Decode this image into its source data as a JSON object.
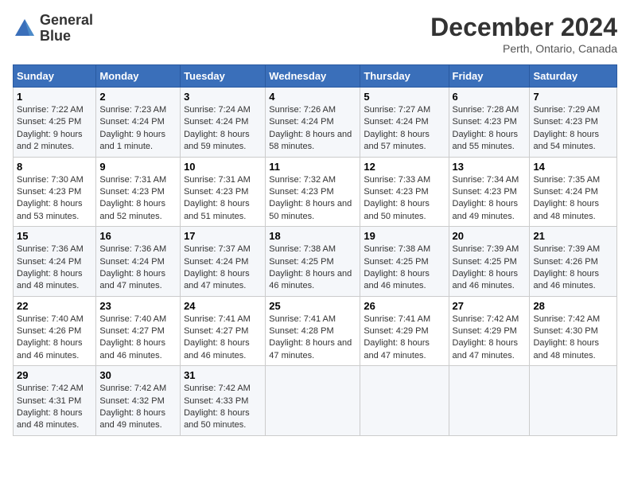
{
  "header": {
    "logo_line1": "General",
    "logo_line2": "Blue",
    "main_title": "December 2024",
    "subtitle": "Perth, Ontario, Canada"
  },
  "days_of_week": [
    "Sunday",
    "Monday",
    "Tuesday",
    "Wednesday",
    "Thursday",
    "Friday",
    "Saturday"
  ],
  "weeks": [
    [
      {
        "day": "1",
        "sunrise": "Sunrise: 7:22 AM",
        "sunset": "Sunset: 4:25 PM",
        "daylight": "Daylight: 9 hours and 2 minutes."
      },
      {
        "day": "2",
        "sunrise": "Sunrise: 7:23 AM",
        "sunset": "Sunset: 4:24 PM",
        "daylight": "Daylight: 9 hours and 1 minute."
      },
      {
        "day": "3",
        "sunrise": "Sunrise: 7:24 AM",
        "sunset": "Sunset: 4:24 PM",
        "daylight": "Daylight: 8 hours and 59 minutes."
      },
      {
        "day": "4",
        "sunrise": "Sunrise: 7:26 AM",
        "sunset": "Sunset: 4:24 PM",
        "daylight": "Daylight: 8 hours and 58 minutes."
      },
      {
        "day": "5",
        "sunrise": "Sunrise: 7:27 AM",
        "sunset": "Sunset: 4:24 PM",
        "daylight": "Daylight: 8 hours and 57 minutes."
      },
      {
        "day": "6",
        "sunrise": "Sunrise: 7:28 AM",
        "sunset": "Sunset: 4:23 PM",
        "daylight": "Daylight: 8 hours and 55 minutes."
      },
      {
        "day": "7",
        "sunrise": "Sunrise: 7:29 AM",
        "sunset": "Sunset: 4:23 PM",
        "daylight": "Daylight: 8 hours and 54 minutes."
      }
    ],
    [
      {
        "day": "8",
        "sunrise": "Sunrise: 7:30 AM",
        "sunset": "Sunset: 4:23 PM",
        "daylight": "Daylight: 8 hours and 53 minutes."
      },
      {
        "day": "9",
        "sunrise": "Sunrise: 7:31 AM",
        "sunset": "Sunset: 4:23 PM",
        "daylight": "Daylight: 8 hours and 52 minutes."
      },
      {
        "day": "10",
        "sunrise": "Sunrise: 7:31 AM",
        "sunset": "Sunset: 4:23 PM",
        "daylight": "Daylight: 8 hours and 51 minutes."
      },
      {
        "day": "11",
        "sunrise": "Sunrise: 7:32 AM",
        "sunset": "Sunset: 4:23 PM",
        "daylight": "Daylight: 8 hours and 50 minutes."
      },
      {
        "day": "12",
        "sunrise": "Sunrise: 7:33 AM",
        "sunset": "Sunset: 4:23 PM",
        "daylight": "Daylight: 8 hours and 50 minutes."
      },
      {
        "day": "13",
        "sunrise": "Sunrise: 7:34 AM",
        "sunset": "Sunset: 4:23 PM",
        "daylight": "Daylight: 8 hours and 49 minutes."
      },
      {
        "day": "14",
        "sunrise": "Sunrise: 7:35 AM",
        "sunset": "Sunset: 4:24 PM",
        "daylight": "Daylight: 8 hours and 48 minutes."
      }
    ],
    [
      {
        "day": "15",
        "sunrise": "Sunrise: 7:36 AM",
        "sunset": "Sunset: 4:24 PM",
        "daylight": "Daylight: 8 hours and 48 minutes."
      },
      {
        "day": "16",
        "sunrise": "Sunrise: 7:36 AM",
        "sunset": "Sunset: 4:24 PM",
        "daylight": "Daylight: 8 hours and 47 minutes."
      },
      {
        "day": "17",
        "sunrise": "Sunrise: 7:37 AM",
        "sunset": "Sunset: 4:24 PM",
        "daylight": "Daylight: 8 hours and 47 minutes."
      },
      {
        "day": "18",
        "sunrise": "Sunrise: 7:38 AM",
        "sunset": "Sunset: 4:25 PM",
        "daylight": "Daylight: 8 hours and 46 minutes."
      },
      {
        "day": "19",
        "sunrise": "Sunrise: 7:38 AM",
        "sunset": "Sunset: 4:25 PM",
        "daylight": "Daylight: 8 hours and 46 minutes."
      },
      {
        "day": "20",
        "sunrise": "Sunrise: 7:39 AM",
        "sunset": "Sunset: 4:25 PM",
        "daylight": "Daylight: 8 hours and 46 minutes."
      },
      {
        "day": "21",
        "sunrise": "Sunrise: 7:39 AM",
        "sunset": "Sunset: 4:26 PM",
        "daylight": "Daylight: 8 hours and 46 minutes."
      }
    ],
    [
      {
        "day": "22",
        "sunrise": "Sunrise: 7:40 AM",
        "sunset": "Sunset: 4:26 PM",
        "daylight": "Daylight: 8 hours and 46 minutes."
      },
      {
        "day": "23",
        "sunrise": "Sunrise: 7:40 AM",
        "sunset": "Sunset: 4:27 PM",
        "daylight": "Daylight: 8 hours and 46 minutes."
      },
      {
        "day": "24",
        "sunrise": "Sunrise: 7:41 AM",
        "sunset": "Sunset: 4:27 PM",
        "daylight": "Daylight: 8 hours and 46 minutes."
      },
      {
        "day": "25",
        "sunrise": "Sunrise: 7:41 AM",
        "sunset": "Sunset: 4:28 PM",
        "daylight": "Daylight: 8 hours and 47 minutes."
      },
      {
        "day": "26",
        "sunrise": "Sunrise: 7:41 AM",
        "sunset": "Sunset: 4:29 PM",
        "daylight": "Daylight: 8 hours and 47 minutes."
      },
      {
        "day": "27",
        "sunrise": "Sunrise: 7:42 AM",
        "sunset": "Sunset: 4:29 PM",
        "daylight": "Daylight: 8 hours and 47 minutes."
      },
      {
        "day": "28",
        "sunrise": "Sunrise: 7:42 AM",
        "sunset": "Sunset: 4:30 PM",
        "daylight": "Daylight: 8 hours and 48 minutes."
      }
    ],
    [
      {
        "day": "29",
        "sunrise": "Sunrise: 7:42 AM",
        "sunset": "Sunset: 4:31 PM",
        "daylight": "Daylight: 8 hours and 48 minutes."
      },
      {
        "day": "30",
        "sunrise": "Sunrise: 7:42 AM",
        "sunset": "Sunset: 4:32 PM",
        "daylight": "Daylight: 8 hours and 49 minutes."
      },
      {
        "day": "31",
        "sunrise": "Sunrise: 7:42 AM",
        "sunset": "Sunset: 4:33 PM",
        "daylight": "Daylight: 8 hours and 50 minutes."
      },
      null,
      null,
      null,
      null
    ]
  ]
}
